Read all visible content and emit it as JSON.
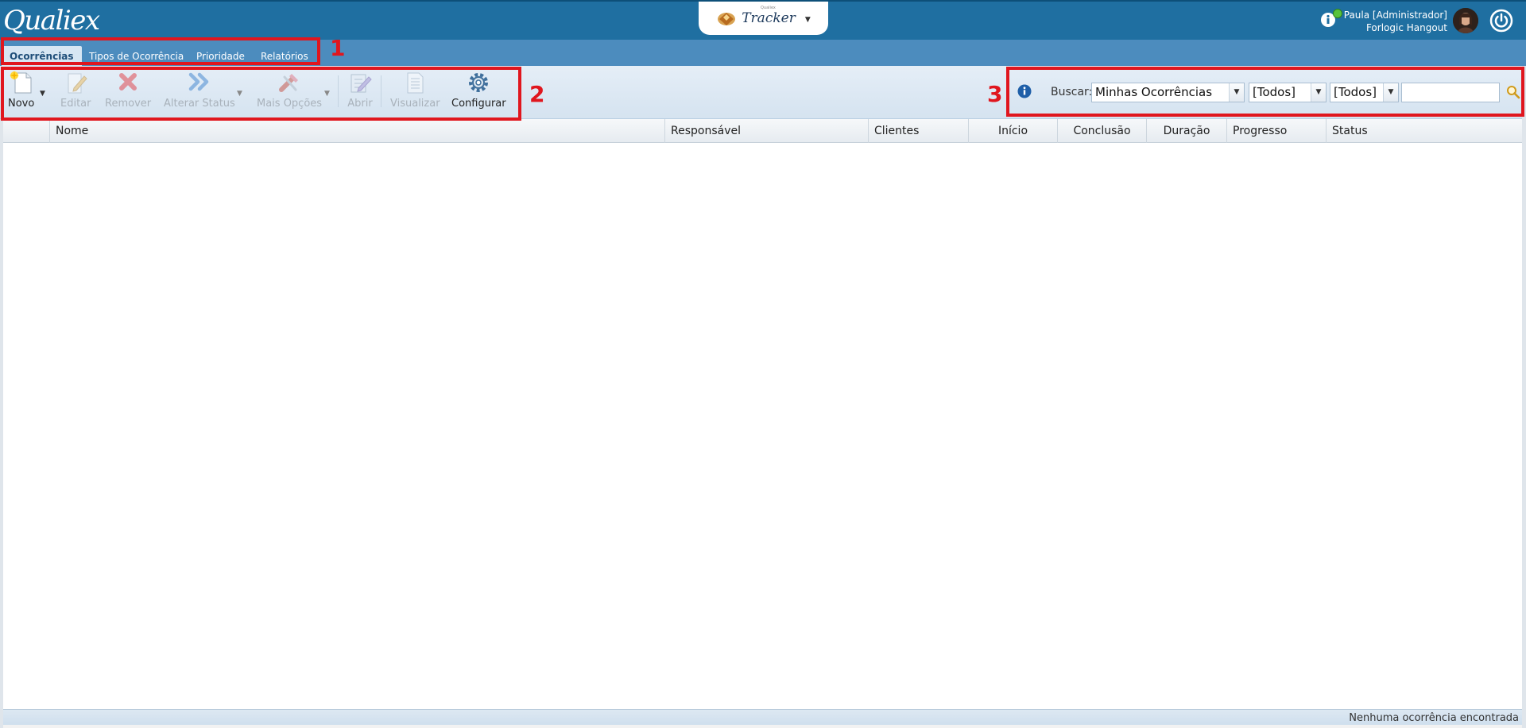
{
  "header": {
    "logo": "Qualiex",
    "app_switcher": {
      "superscript": "Qualiex",
      "name": "Tracker"
    },
    "user": {
      "name": "Paula [Administrador]",
      "company": "Forlogic Hangout"
    }
  },
  "nav": {
    "tabs": [
      {
        "label": "Ocorrências",
        "active": true
      },
      {
        "label": "Tipos de Ocorrência",
        "active": false
      },
      {
        "label": "Prioridade",
        "active": false
      },
      {
        "label": "Relatórios",
        "active": false
      }
    ]
  },
  "toolbar": {
    "new": "Novo",
    "edit": "Editar",
    "remove": "Remover",
    "change_status": "Alterar Status",
    "more_options": "Mais Opções",
    "open": "Abrir",
    "view": "Visualizar",
    "configure": "Configurar"
  },
  "search": {
    "label": "Buscar:",
    "filter_main": "Minhas Ocorrências",
    "filter_2": "[Todos]",
    "filter_3": "[Todos]",
    "query": ""
  },
  "grid": {
    "columns": [
      "Nome",
      "Responsável",
      "Clientes",
      "Início",
      "Conclusão",
      "Duração",
      "Progresso",
      "Status"
    ],
    "rows": []
  },
  "statusbar": {
    "text": "Nenhuma ocorrência encontrada"
  },
  "annotations": [
    "1",
    "2",
    "3"
  ],
  "colors": {
    "header": "#1f6fa1",
    "navbar": "#4c8cbe",
    "annotation": "#e0161e"
  }
}
